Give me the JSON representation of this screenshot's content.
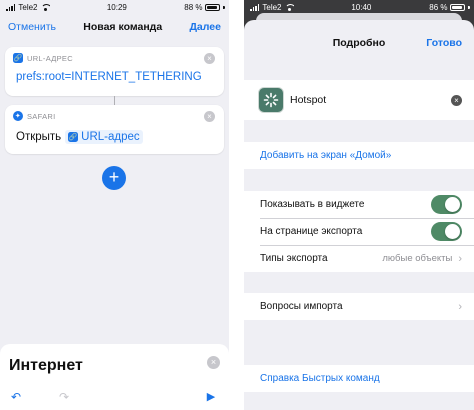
{
  "left": {
    "status": {
      "carrier": "Tele2",
      "time": "10:29",
      "battery": "88 %",
      "battery_level": 0.88
    },
    "nav": {
      "cancel": "Отменить",
      "title": "Новая команда",
      "next": "Далее"
    },
    "url_action": {
      "header": "URL-АДРЕС",
      "value": "prefs:root=INTERNET_TETHERING",
      "icon": "link-icon"
    },
    "safari_action": {
      "header": "SAFARI",
      "open_label": "Открыть",
      "token": "URL-адрес",
      "icon": "compass-icon"
    },
    "search": {
      "value": "Интернет"
    },
    "toolbar": {
      "undo_icon": "undo-icon",
      "redo_icon": "redo-icon",
      "play_icon": "play-icon"
    },
    "accent": "#1a74e8"
  },
  "right": {
    "status": {
      "carrier": "Tele2",
      "time": "10:40",
      "battery": "86 %",
      "battery_level": 0.86
    },
    "nav": {
      "title": "Подробно",
      "done": "Готово"
    },
    "shortcut": {
      "name": "Hotspot",
      "icon": "hotspot-icon"
    },
    "add_home": "Добавить на экран «Домой»",
    "settings": {
      "show_widget": {
        "label": "Показывать в виджете",
        "on": true
      },
      "share_sheet": {
        "label": "На странице экспорта",
        "on": true
      },
      "share_types": {
        "label": "Типы экспорта",
        "value": "любые объекты"
      }
    },
    "import_questions": "Вопросы импорта",
    "help": "Справка Быстрых команд",
    "toggle_color": "#4f8a66"
  }
}
